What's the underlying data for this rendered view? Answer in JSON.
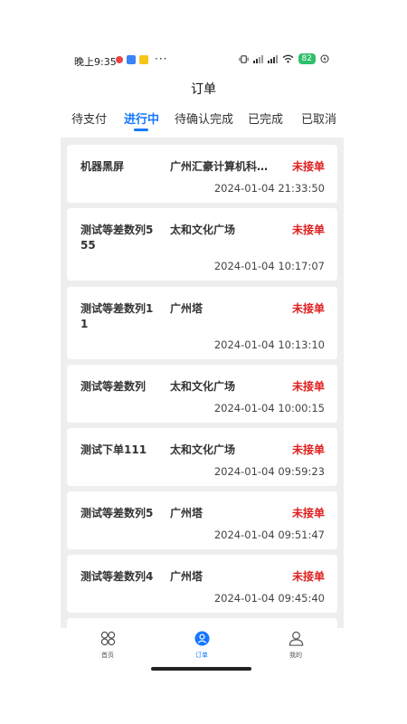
{
  "status_bar": {
    "time": "晚上9:35",
    "more": "···",
    "battery": "82"
  },
  "header": {
    "title": "订单"
  },
  "tabs": [
    {
      "label": "待支付",
      "active": false
    },
    {
      "label": "进行中",
      "active": true
    },
    {
      "label": "待确认完成",
      "active": false
    },
    {
      "label": "已完成",
      "active": false
    },
    {
      "label": "已取消",
      "active": false
    }
  ],
  "orders": [
    {
      "name": "机器黑屏",
      "place": "广州汇豪计算机科技…",
      "status": "未接单",
      "time": "2024-01-04 21:33:50"
    },
    {
      "name": "测试等差数列555",
      "place": "太和文化广场",
      "status": "未接单",
      "time": "2024-01-04 10:17:07"
    },
    {
      "name": "测试等差数列11",
      "place": "广州塔",
      "status": "未接单",
      "time": "2024-01-04 10:13:10"
    },
    {
      "name": "测试等差数列",
      "place": "太和文化广场",
      "status": "未接单",
      "time": "2024-01-04 10:00:15"
    },
    {
      "name": "测试下单111",
      "place": "太和文化广场",
      "status": "未接单",
      "time": "2024-01-04 09:59:23"
    },
    {
      "name": "测试等差数列5",
      "place": "广州塔",
      "status": "未接单",
      "time": "2024-01-04 09:51:47"
    },
    {
      "name": "测试等差数列4",
      "place": "广州塔",
      "status": "未接单",
      "time": "2024-01-04 09:45:40"
    }
  ],
  "bottom_nav": [
    {
      "label": "首页",
      "icon": "grid-icon",
      "active": false
    },
    {
      "label": "订单",
      "icon": "person-circle-icon",
      "active": true
    },
    {
      "label": "我的",
      "icon": "user-icon",
      "active": false
    }
  ],
  "colors": {
    "accent": "#1677ff",
    "status_red": "#e02020",
    "list_bg": "#eeeeee"
  }
}
